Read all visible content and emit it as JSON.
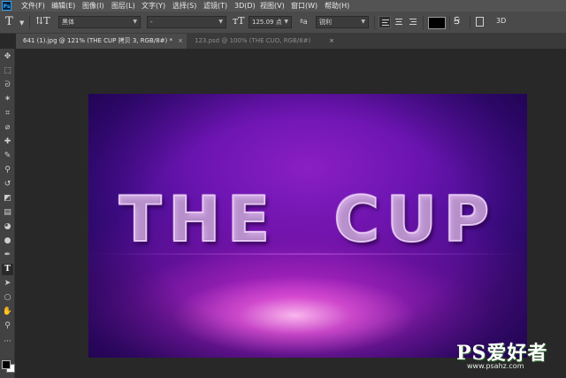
{
  "app": {
    "logo_text": "Ps",
    "menu": [
      "文件(F)",
      "编辑(E)",
      "图像(I)",
      "图层(L)",
      "文字(Y)",
      "选择(S)",
      "滤镜(T)",
      "3D(D)",
      "视图(V)",
      "窗口(W)",
      "帮助(H)"
    ]
  },
  "options_bar": {
    "font_family": "黑体",
    "font_style": "-",
    "font_size": "125.09 点",
    "antialias_symbol": "ªa",
    "antialias": "锐利",
    "text_color": "#000000",
    "mode_3d": "3D"
  },
  "tabs": [
    {
      "label": "641 (1).jpg @ 121% (THE CUP 拷贝 3, RGB/8#) *",
      "close": "×"
    },
    {
      "label": "123.psd @ 100% (THE CUO, RGB/8#)",
      "close": "×"
    }
  ],
  "tools": [
    {
      "name": "move-tool",
      "glyph": "✥"
    },
    {
      "name": "marquee-tool",
      "glyph": "⬚"
    },
    {
      "name": "lasso-tool",
      "glyph": "ᘐ"
    },
    {
      "name": "magic-wand-tool",
      "glyph": "✶"
    },
    {
      "name": "crop-tool",
      "glyph": "⌗"
    },
    {
      "name": "eyedropper-tool",
      "glyph": "⌀"
    },
    {
      "name": "healing-brush-tool",
      "glyph": "✚"
    },
    {
      "name": "brush-tool",
      "glyph": "✎"
    },
    {
      "name": "clone-stamp-tool",
      "glyph": "⚲"
    },
    {
      "name": "history-brush-tool",
      "glyph": "↺"
    },
    {
      "name": "eraser-tool",
      "glyph": "◩"
    },
    {
      "name": "gradient-tool",
      "glyph": "▤"
    },
    {
      "name": "blur-tool",
      "glyph": "◕"
    },
    {
      "name": "dodge-tool",
      "glyph": "●"
    },
    {
      "name": "pen-tool",
      "glyph": "✒"
    },
    {
      "name": "type-tool",
      "glyph": "T"
    },
    {
      "name": "path-selection-tool",
      "glyph": "➤"
    },
    {
      "name": "ellipse-tool",
      "glyph": "○"
    },
    {
      "name": "hand-tool",
      "glyph": "✋"
    },
    {
      "name": "zoom-tool",
      "glyph": "⚲"
    },
    {
      "name": "more-tools",
      "glyph": "···"
    }
  ],
  "canvas": {
    "headline": "THE  CUP"
  },
  "watermark": {
    "title": "PS爱好者",
    "url": "www.psahz.com"
  }
}
